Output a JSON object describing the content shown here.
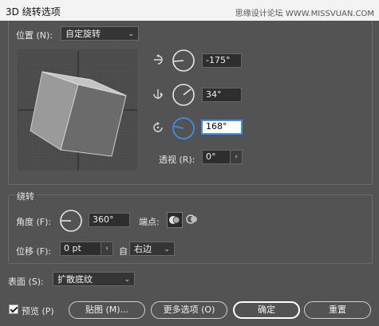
{
  "window": {
    "title": "3D 绕转选项",
    "watermark": "思缘设计论坛 WWW.MISSVUAN.COM"
  },
  "position": {
    "label": "位置 (N):",
    "value": "自定旋转"
  },
  "rotation": {
    "x_value": "-175°",
    "y_value": "34°",
    "z_value": "168°"
  },
  "perspective": {
    "label": "透视 (R):",
    "value": "0°"
  },
  "revolve": {
    "section_label": "绕转",
    "angle_label": "角度 (F):",
    "angle_value": "360°",
    "endpoints_label": "端点:",
    "offset_label": "位移 (F):",
    "offset_value": "0 pt",
    "from_label": "自",
    "from_value": "右边"
  },
  "surface": {
    "label": "表面 (S):",
    "value": "扩散底纹"
  },
  "buttons": {
    "preview_label": "预览 (P)",
    "map_label": "贴图 (M)...",
    "more_label": "更多选项 (O)",
    "ok_label": "确定",
    "reset_label": "重置"
  },
  "colors": {
    "accent": "#3a8ee6",
    "bg": "#535353",
    "field": "#2e2e2e"
  },
  "icons": [
    "rotate-x-icon",
    "rotate-y-icon",
    "rotate-z-icon",
    "angle-dial-icon",
    "cap-on-icon",
    "cap-off-icon",
    "chevron-down-icon",
    "chevron-right-icon",
    "checkbox-icon"
  ]
}
